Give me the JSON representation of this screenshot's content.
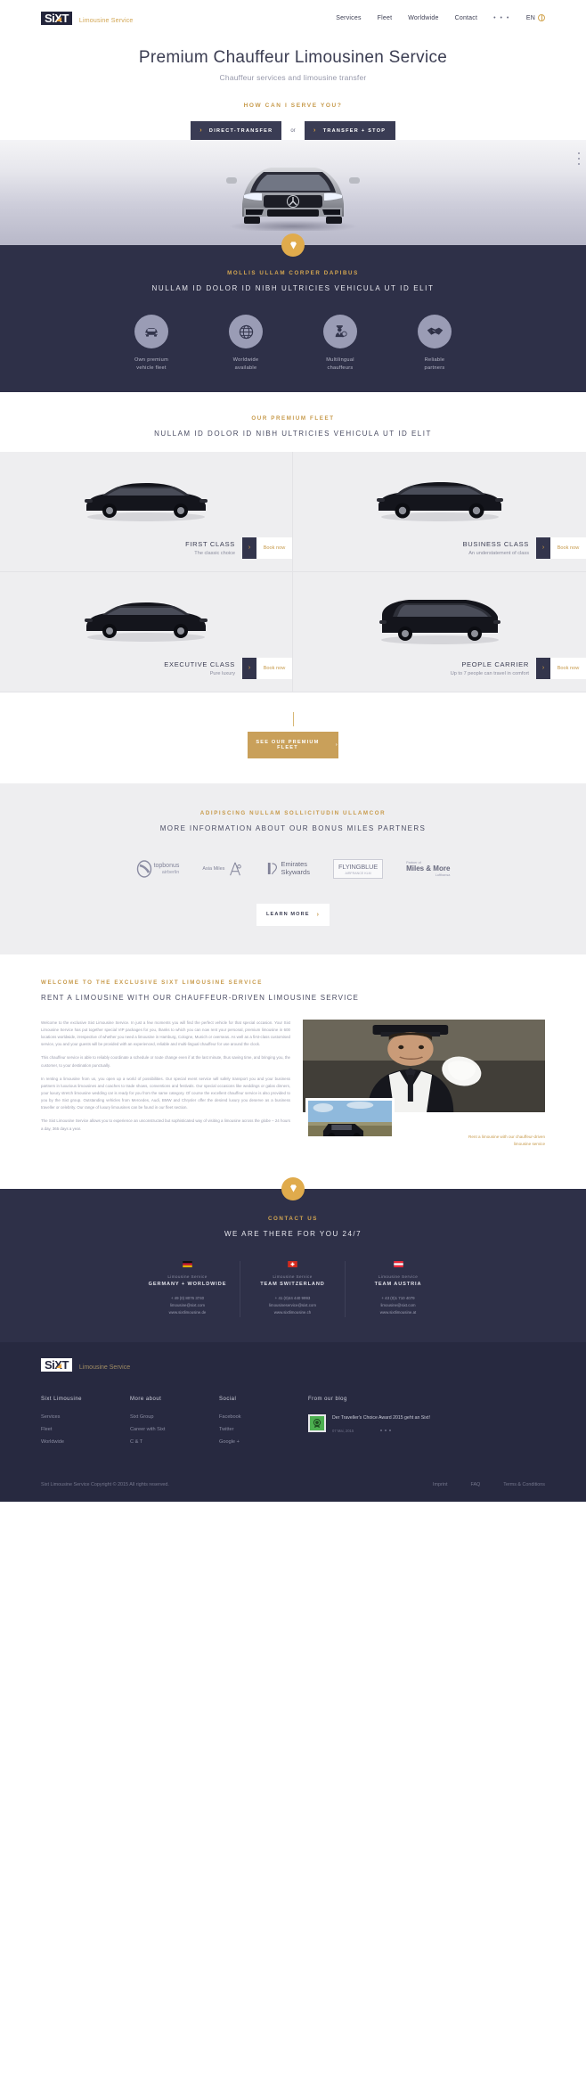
{
  "header": {
    "logo_text": "SiXT",
    "logo_sub": "Limousine Service",
    "nav": [
      {
        "label": "Services"
      },
      {
        "label": "Fleet"
      },
      {
        "label": "Worldwide"
      },
      {
        "label": "Contact"
      }
    ],
    "more_dots": "• • •",
    "lang": "EN"
  },
  "hero": {
    "title": "Premium Chauffeur Limousinen Service",
    "subtitle": "Chauffeur services and limousine transfer",
    "eyebrow": "HOW CAN I SERVE YOU?",
    "btn_direct": "DIRECT-TRANSFER",
    "btn_or": "or",
    "btn_stop": "TRANSFER + STOP",
    "chevron": "›"
  },
  "features": {
    "eyebrow": "MOLLIS ULLAM CORPER DAPIBUS",
    "title": "NULLAM ID DOLOR ID NIBH ULTRICIES VEHICULA UT ID ELIT",
    "items": [
      {
        "icon": "car-icon",
        "label": "Own premium\nvehicle fleet",
        "line1": "Own premium",
        "line2": "vehicle fleet"
      },
      {
        "icon": "globe-icon",
        "label": "Worldwide available",
        "line1": "Worldwide",
        "line2": "available"
      },
      {
        "icon": "chauffeur-icon",
        "label": "Multilingual chauffeurs",
        "line1": "Multilingual",
        "line2": "chauffeurs"
      },
      {
        "icon": "handshake-icon",
        "label": "Reliable partners",
        "line1": "Reliable",
        "line2": "partners"
      }
    ]
  },
  "fleet": {
    "eyebrow": "OUR PREMIUM FLEET",
    "title": "NULLAM ID DOLOR ID NIBH ULTRICIES VEHICULA UT ID ELIT",
    "book_label": "Book now",
    "chevron": "›",
    "cards": [
      {
        "name": "FIRST CLASS",
        "desc": "The classic choice"
      },
      {
        "name": "BUSINESS CLASS",
        "desc": "An understatement of class"
      },
      {
        "name": "EXECUTIVE CLASS",
        "desc": "Pure luxury"
      },
      {
        "name": "PEOPLE CARRIER",
        "desc": "Up to 7 people can travel in comfort"
      }
    ],
    "cta": "SEE OUR PREMIUM FLEET"
  },
  "partners": {
    "eyebrow": "ADIPISCING NULLAM SOLLICITUDIN ULLAMCOR",
    "title": "MORE INFORMATION ABOUT OUR BONUS MILES PARTNERS",
    "logos": [
      {
        "name": "topbonus airberlin",
        "line1": "topbonus",
        "line2": "airberlin"
      },
      {
        "name": "Asia Miles",
        "line1": "Asia Miles",
        "line2": ""
      },
      {
        "name": "Emirates Skywards",
        "line1": "Emirates",
        "line2": "Skywards"
      },
      {
        "name": "FLYINGBLUE",
        "line1": "FLYINGBLUE",
        "line2": "AIRFRANCE KLM"
      },
      {
        "name": "Miles & More",
        "line1": "Partner of",
        "line2": "Miles & More",
        "line3": "Lufthansa"
      }
    ],
    "cta": "LEARN MORE"
  },
  "welcome": {
    "eyebrow": "WELCOME TO THE EXCLUSIVE SIXT LIMOUSINE SERVICE",
    "title": "RENT A LIMOUSINE WITH OUR CHAUFFEUR-DRIVEN LIMOUSINE SERVICE",
    "paragraphs": [
      "Welcome to the exclusive Sixt Limousine Service. In just a few moments you will find the perfect vehicle for that special occasion. Your Sixt Limousine Service has put together special VIP packages for you, thanks to which you can now rent your personal, premium limousine in 600 locations worldwide, irrespective of whether you need a limousine in Hamburg, Cologne, Munich or overseas. As well as a first-class customised service, you and your guests will be provided with an experienced, reliable and multi-lingual chauffeur for use around the clock.",
      "This chauffeur service is able to reliably coordinate a schedule or route change even if at the last minute, thus saving time, and bringing you, the customer, to your destination punctually.",
      "In renting a limousine from us, you open up a world of possibilities. Our special event service will safely transport you and your business partners in luxurious limousines and coaches to trade shows, conventions and festivals. Our special occasions like weddings or galas dinners, your luxury stretch limousine wedding car is ready for you from the same category. Of course the excellent chauffeur service is also provided to you by the Sixt group. Outstanding vehicles from Mercedes, Audi, BMW and Chrysler offer the desired luxury you deserve as a business traveller or celebrity. Our range of luxury limousines can be found in our fleet section.",
      "The Sixt Limousine Service allows you to experience an unconstructed but sophisticated way of visiting a limousine across the globe – 24 hours a day, 365 days a year."
    ],
    "caption": "Rent a limousine with our chauffeur-driven limousine service"
  },
  "contact": {
    "eyebrow": "CONTACT US",
    "title": "WE ARE THERE FOR YOU 24/7",
    "offices": [
      {
        "kicker": "Limousine Service",
        "city": "GERMANY + WORLDWIDE",
        "flag": "de",
        "phone": "+ 49 (0) 8076 3740",
        "email": "limousine@sixt.com",
        "web": "www.sixtlimousine.de"
      },
      {
        "kicker": "Limousine Service",
        "city": "TEAM SWITZERLAND",
        "flag": "ch",
        "phone": "+ 41 (0)44 440 9993",
        "email": "limousineservice@sixt.com",
        "web": "www.sixtlimousine.ch"
      },
      {
        "kicker": "Limousine Service",
        "city": "TEAM AUSTRIA",
        "flag": "at",
        "phone": "+ 43 (0)1 710 4079",
        "email": "limousine@sixt.com",
        "web": "www.sixtlimousine.at"
      }
    ]
  },
  "footer": {
    "logo_text": "SiXT",
    "logo_sub": "Limousine Service",
    "columns": [
      {
        "heading": "Sixt Limousine",
        "links": [
          "Services",
          "Fleet",
          "Worldwide"
        ]
      },
      {
        "heading": "More about",
        "links": [
          "Sixt Group",
          "Career with Sixt",
          "C & T"
        ]
      },
      {
        "heading": "Social",
        "links": [
          "Facebook",
          "Twitter",
          "Google +"
        ]
      }
    ],
    "blog": {
      "heading": "From our blog",
      "title": "Der Traveller's Choice Award 2015 geht an Sixt!",
      "date": "07 Mai, 2015"
    },
    "copyright": "Sixt Limousine Service Copyright © 2015 All rights reserved.",
    "legal": [
      "Imprint",
      "FAQ",
      "Terms & Conditions"
    ]
  },
  "colors": {
    "gold": "#c9a05a",
    "dark": "#2e3048",
    "footer_dark": "#272940",
    "light_grey": "#eeeef0"
  }
}
